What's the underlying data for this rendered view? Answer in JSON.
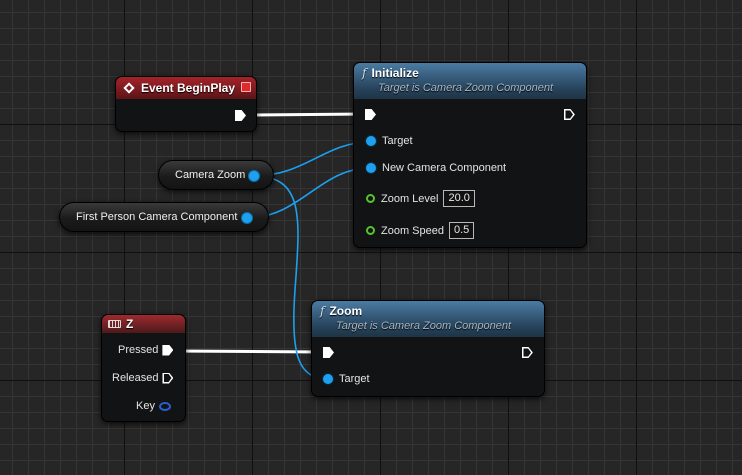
{
  "nodes": {
    "event_begin_play": {
      "title": "Event BeginPlay"
    },
    "initialize": {
      "title": "Initialize",
      "subtitle": "Target is Camera Zoom Component",
      "pins": {
        "target": "Target",
        "new_camera_component": "New Camera Component",
        "zoom_level": "Zoom Level",
        "zoom_level_value": "20.0",
        "zoom_speed": "Zoom Speed",
        "zoom_speed_value": "0.5"
      }
    },
    "camera_zoom": {
      "label": "Camera Zoom"
    },
    "first_person_camera": {
      "label": "First Person Camera Component"
    },
    "key_z": {
      "title": "Z",
      "pins": {
        "pressed": "Pressed",
        "released": "Released",
        "key": "Key"
      }
    },
    "zoom": {
      "title": "Zoom",
      "subtitle": "Target is Camera Zoom Component",
      "pins": {
        "target": "Target"
      }
    }
  },
  "icons": {
    "event": "event-diamond-icon",
    "function": "function-f-icon",
    "keyboard": "keyboard-icon"
  },
  "colors": {
    "exec_wire": "#ffffff",
    "object_wire": "#1ca0ef",
    "float_pin": "#58c42c",
    "key_pin": "#2a5fd6",
    "event_header": "#a32329",
    "function_header": "#4b7ba3"
  }
}
